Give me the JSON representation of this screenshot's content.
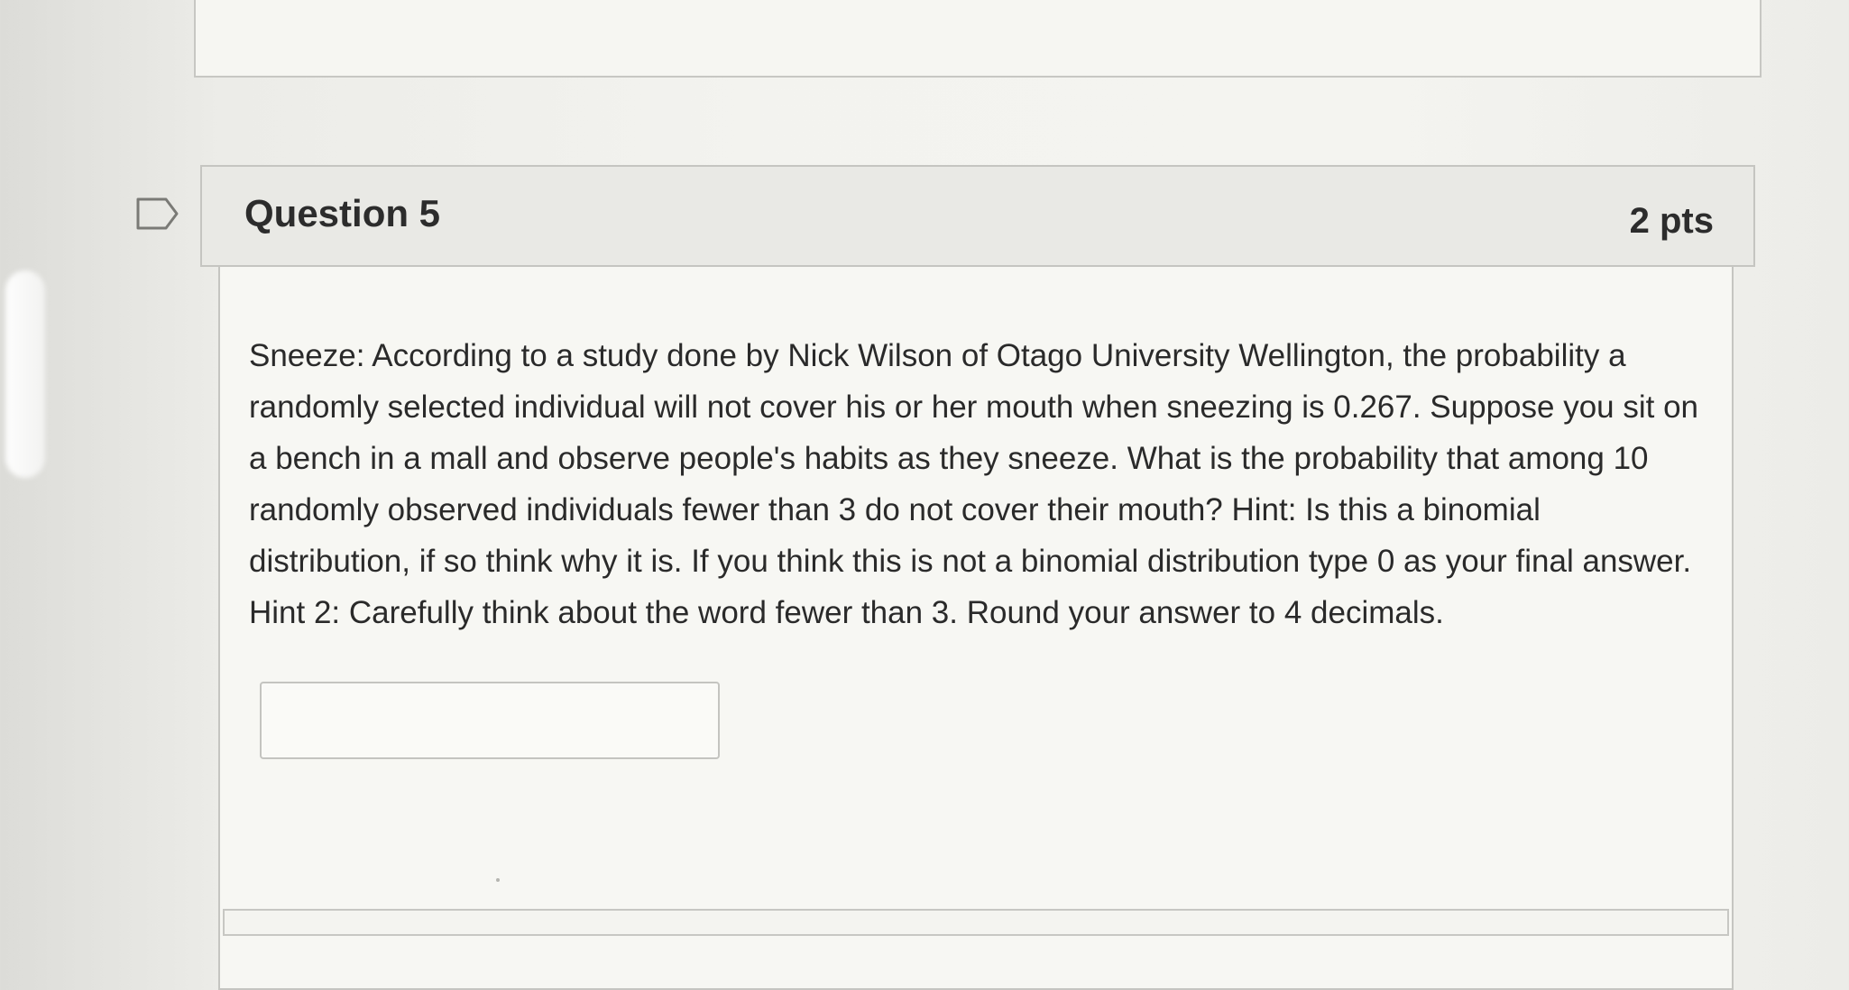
{
  "question": {
    "title": "Question 5",
    "points": "2 pts",
    "text": "Sneeze: According to a study done by Nick Wilson of Otago University Wellington, the probability a randomly selected individual will not cover his or her mouth when sneezing is 0.267. Suppose you sit on a bench in a mall and observe people's habits as they sneeze. What is the probability that among 10 randomly observed individuals fewer than 3 do not cover their mouth? Hint: Is this a binomial distribution, if so think why it is. If you think this is not a binomial distribution type 0 as your final answer. Hint 2: Carefully think about the word fewer than 3.  Round your answer to 4 decimals.",
    "answer_value": "",
    "flag_icon": "flag-outline-icon"
  },
  "colors": {
    "header_bg": "#e9e9e5",
    "border": "#c5c5c1",
    "text": "#2a2a2a"
  }
}
